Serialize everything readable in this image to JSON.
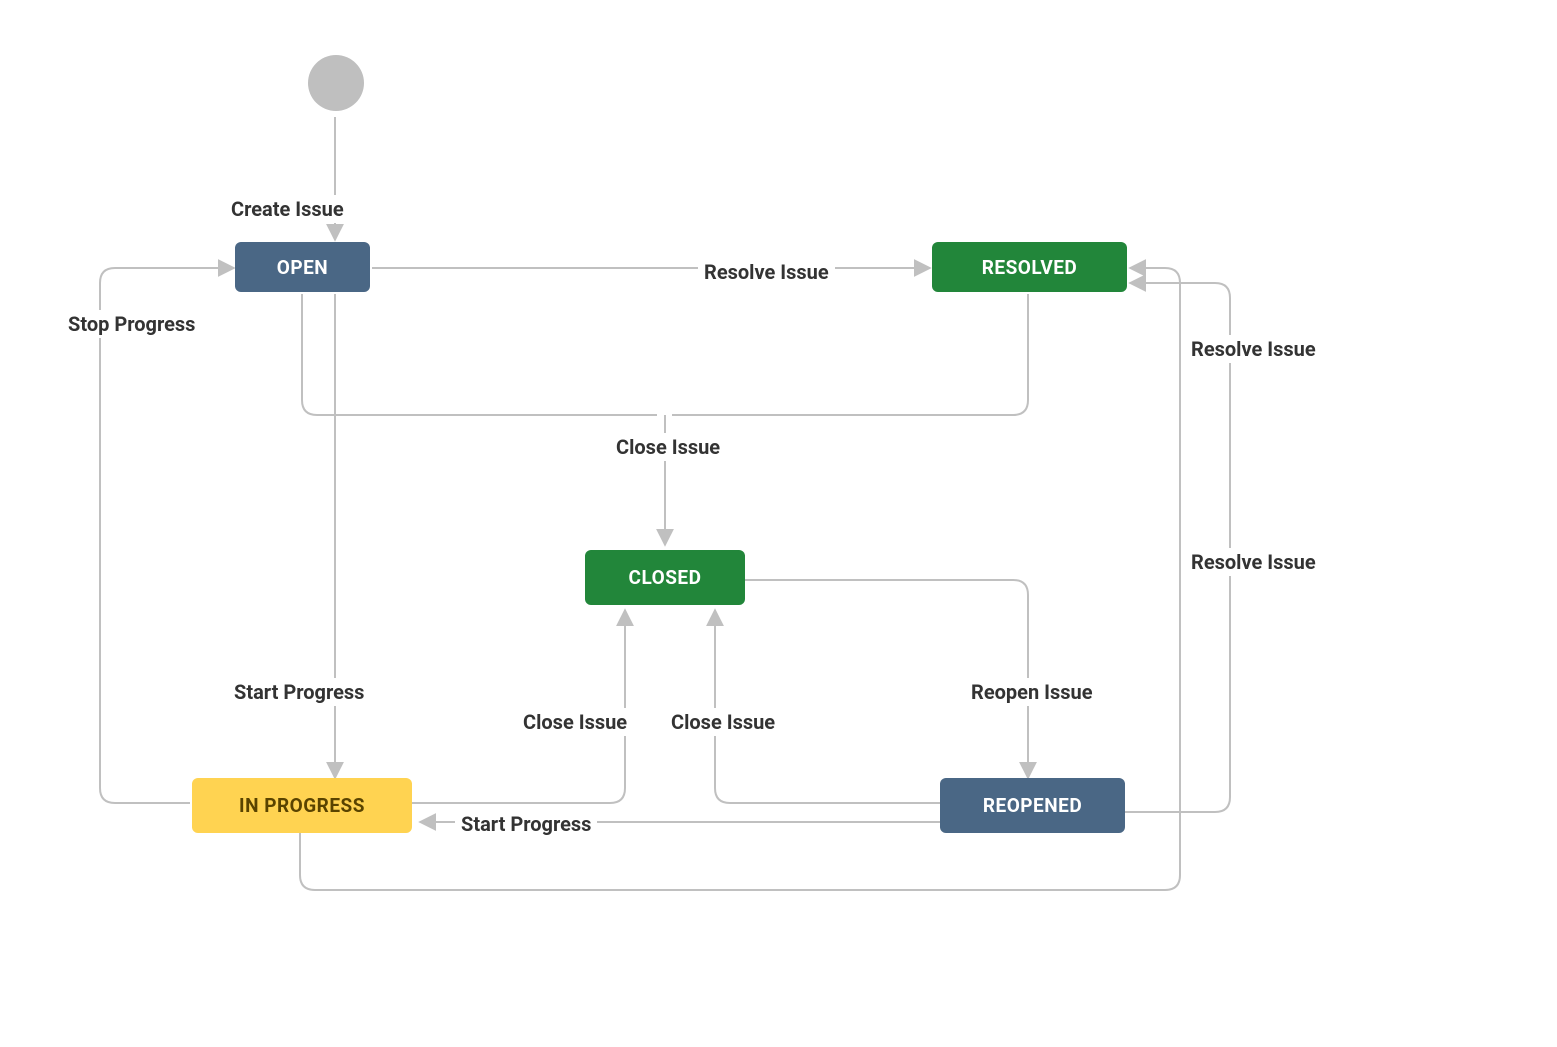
{
  "diagram": {
    "nodes": {
      "open": {
        "label": "OPEN"
      },
      "resolved": {
        "label": "RESOLVED"
      },
      "closed": {
        "label": "CLOSED"
      },
      "inprogress": {
        "label": "IN PROGRESS"
      },
      "reopened": {
        "label": "REOPENED"
      }
    },
    "edges": {
      "create_issue": {
        "label": "Create Issue"
      },
      "resolve_issue_open": {
        "label": "Resolve Issue"
      },
      "stop_progress": {
        "label": "Stop Progress"
      },
      "close_issue_top": {
        "label": "Close Issue"
      },
      "start_progress_open": {
        "label": "Start Progress"
      },
      "close_issue_left": {
        "label": "Close Issue"
      },
      "close_issue_right": {
        "label": "Close Issue"
      },
      "start_progress_reop": {
        "label": "Start Progress"
      },
      "reopen_issue": {
        "label": "Reopen Issue"
      },
      "resolve_issue_r1": {
        "label": "Resolve Issue"
      },
      "resolve_issue_r2": {
        "label": "Resolve Issue"
      }
    },
    "colors": {
      "edge": "#c0c0c0",
      "arrow": "#c0c0c0",
      "label": "#333333",
      "open": "#4a6785",
      "green": "#22863a",
      "yellow": "#ffd351"
    }
  }
}
